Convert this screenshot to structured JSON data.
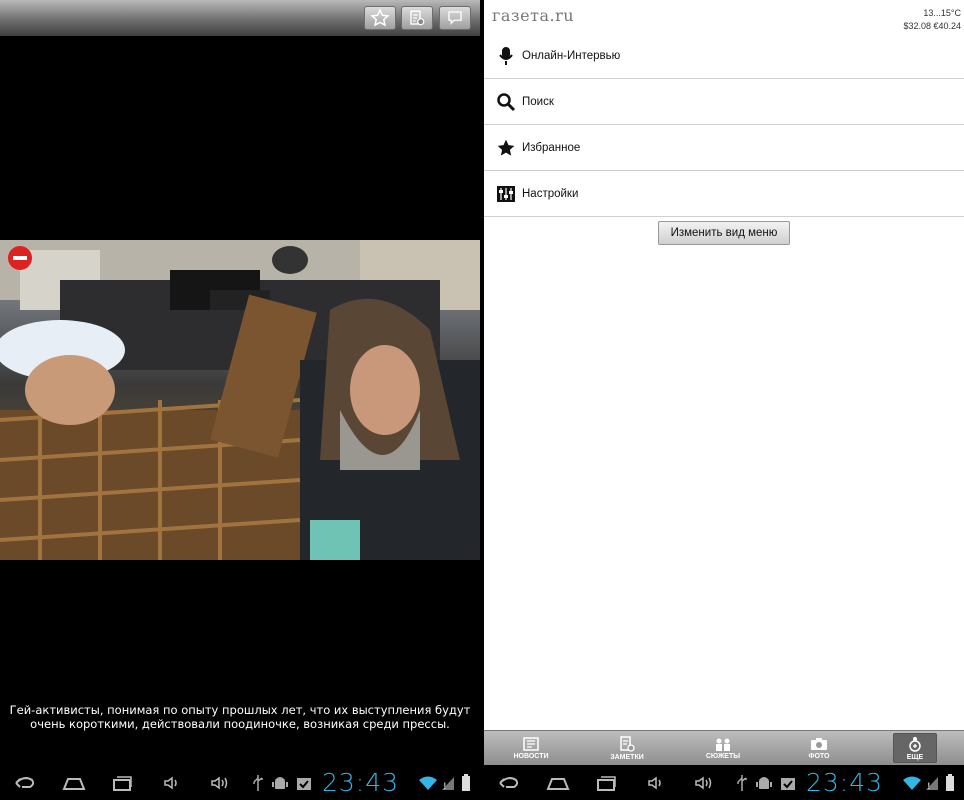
{
  "left": {
    "toolbar": {
      "buttons": [
        "star-icon",
        "note-icon",
        "comment-icon"
      ]
    },
    "caption": "Гей-активисты, понимая по опыту прошлых лет, что их выступления будут очень короткими, действовали поодиночке, возникая среди прессы."
  },
  "right": {
    "logo": "газета.ru",
    "weather": {
      "temp": "13...15°C",
      "rates": "$32.08 €40.24"
    },
    "menu": [
      {
        "label": "Онлайн-Интервью",
        "icon": "microphone-icon"
      },
      {
        "label": "Поиск",
        "icon": "search-icon"
      },
      {
        "label": "Избранное",
        "icon": "star-icon"
      },
      {
        "label": "Настройки",
        "icon": "settings-icon"
      }
    ],
    "change_view_label": "Изменить вид меню",
    "tabs": [
      {
        "label": "НОВОСТИ",
        "icon": "news-icon"
      },
      {
        "label": "ЗАМЕТКИ",
        "icon": "notes-icon"
      },
      {
        "label": "СЮЖЕТЫ",
        "icon": "stories-icon"
      },
      {
        "label": "ФОТО",
        "icon": "camera-icon"
      },
      {
        "label": "ЕЩЕ",
        "icon": "more-icon",
        "active": true
      }
    ]
  },
  "status": {
    "time": "23:43"
  },
  "colors": {
    "clock": "#33b5e5",
    "tabbar": "#9e9e9e"
  }
}
